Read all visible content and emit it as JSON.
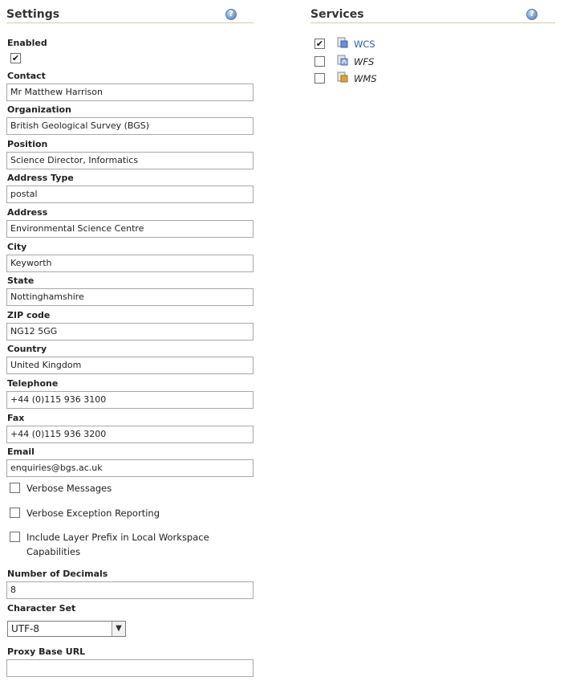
{
  "settings": {
    "title": "Settings",
    "enabled": {
      "label": "Enabled",
      "checked": true
    },
    "fields": [
      {
        "label": "Contact",
        "value": "Mr Matthew Harrison"
      },
      {
        "label": "Organization",
        "value": "British Geological Survey (BGS)"
      },
      {
        "label": "Position",
        "value": "Science Director, Informatics"
      },
      {
        "label": "Address Type",
        "value": "postal"
      },
      {
        "label": "Address",
        "value": "Environmental Science Centre"
      },
      {
        "label": "City",
        "value": "Keyworth"
      },
      {
        "label": "State",
        "value": "Nottinghamshire"
      },
      {
        "label": "ZIP code",
        "value": "NG12 5GG"
      },
      {
        "label": "Country",
        "value": "United Kingdom"
      },
      {
        "label": "Telephone",
        "value": "+44 (0)115 936 3100"
      },
      {
        "label": "Fax",
        "value": "+44 (0)115 936 3200"
      },
      {
        "label": "Email",
        "value": "enquiries@bgs.ac.uk"
      }
    ],
    "options": [
      {
        "label": "Verbose Messages",
        "checked": false
      },
      {
        "label": "Verbose Exception Reporting",
        "checked": false
      },
      {
        "label": "Include Layer Prefix in Local Workspace Capabilities",
        "checked": false
      }
    ],
    "decimals": {
      "label": "Number of Decimals",
      "value": "8"
    },
    "charset": {
      "label": "Character Set",
      "value": "UTF-8"
    },
    "proxy": {
      "label": "Proxy Base URL",
      "value": ""
    }
  },
  "services": {
    "title": "Services",
    "items": [
      {
        "label": "WCS",
        "checked": true,
        "icon": "wcs-service-icon"
      },
      {
        "label": "WFS",
        "checked": false,
        "icon": "wfs-service-icon"
      },
      {
        "label": "WMS",
        "checked": false,
        "icon": "wms-service-icon"
      }
    ]
  }
}
